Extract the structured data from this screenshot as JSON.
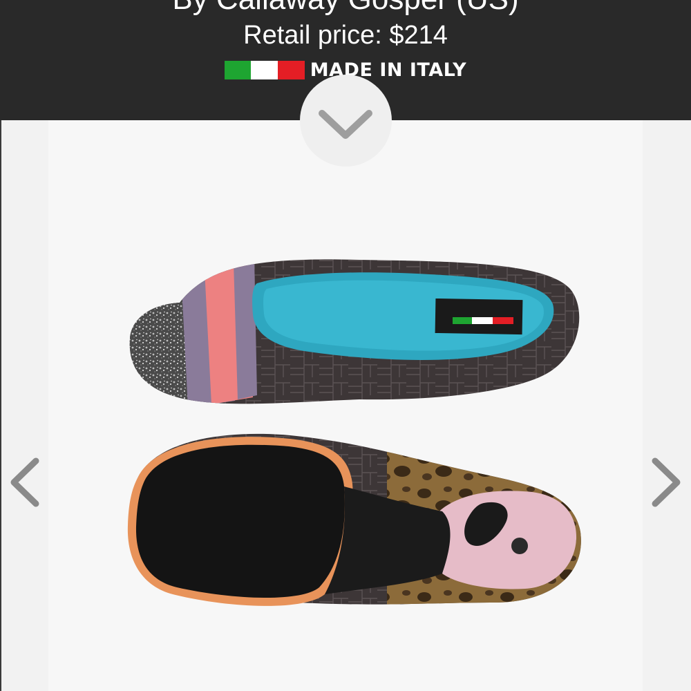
{
  "header": {
    "designer_line": "By Callaway Gosper (US)",
    "price_line": "Retail price: $214",
    "made_in": "MADE IN ITALY",
    "flag_colors": [
      "#1ea531",
      "#ffffff",
      "#e41e25"
    ],
    "background_color": "#292929"
  },
  "controls": {
    "expand_icon": "chevron-down-icon",
    "prev_icon": "chevron-left-icon",
    "next_icon": "chevron-right-icon"
  },
  "product": {
    "image_description_icon": "shoe-product-image",
    "insole_label_icon": "italian-flag-label"
  }
}
